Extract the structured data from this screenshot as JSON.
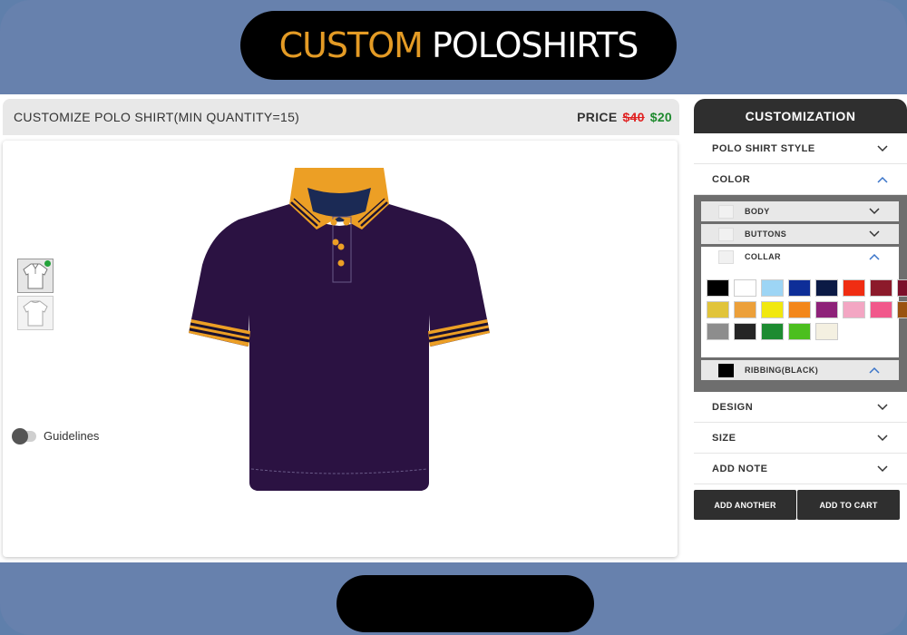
{
  "banner": {
    "title_part1": "CUSTOM",
    "title_part2": "POLOSHIRTS"
  },
  "header": {
    "title": "CUSTOMIZE POLO SHIRT(MIN QUANTITY=15)",
    "price_label": "PRICE",
    "price_old": "$40",
    "price_new": "$20"
  },
  "canvas": {
    "views": [
      "front",
      "back"
    ],
    "guidelines_label": "Guidelines",
    "shirt_colors": {
      "body": "#2b1242",
      "collar": "#ec9f25",
      "stripe": "#1a1030",
      "buttons": "#ec9f25",
      "inner": "#1b2a55"
    }
  },
  "sidebar": {
    "title": "CUSTOMIZATION",
    "sections": {
      "style": "POLO SHIRT STYLE",
      "color": "COLOR",
      "design": "DESIGN",
      "size": "SIZE",
      "note": "ADD NOTE"
    },
    "color_parts": {
      "body": "BODY",
      "buttons": "BUTTONS",
      "collar": "COLLAR",
      "ribbing": "RIBBING(BLACK)"
    },
    "palette": [
      "#000000",
      "#ffffff",
      "#9dd5f5",
      "#0e2e98",
      "#0b1a45",
      "#f02d12",
      "#8c1a2b",
      "#7c0f2a",
      "#e1c43a",
      "#eca03a",
      "#f1e80f",
      "#f3861a",
      "#8e2279",
      "#f3a6c3",
      "#f1588b",
      "#9a5310",
      "#8d8d8d",
      "#252525",
      "#1d8b31",
      "#4cbf1f",
      "#f4f0e1"
    ],
    "buttons": {
      "add_another": "ADD ANOTHER",
      "add_to_cart": "ADD TO CART"
    }
  }
}
